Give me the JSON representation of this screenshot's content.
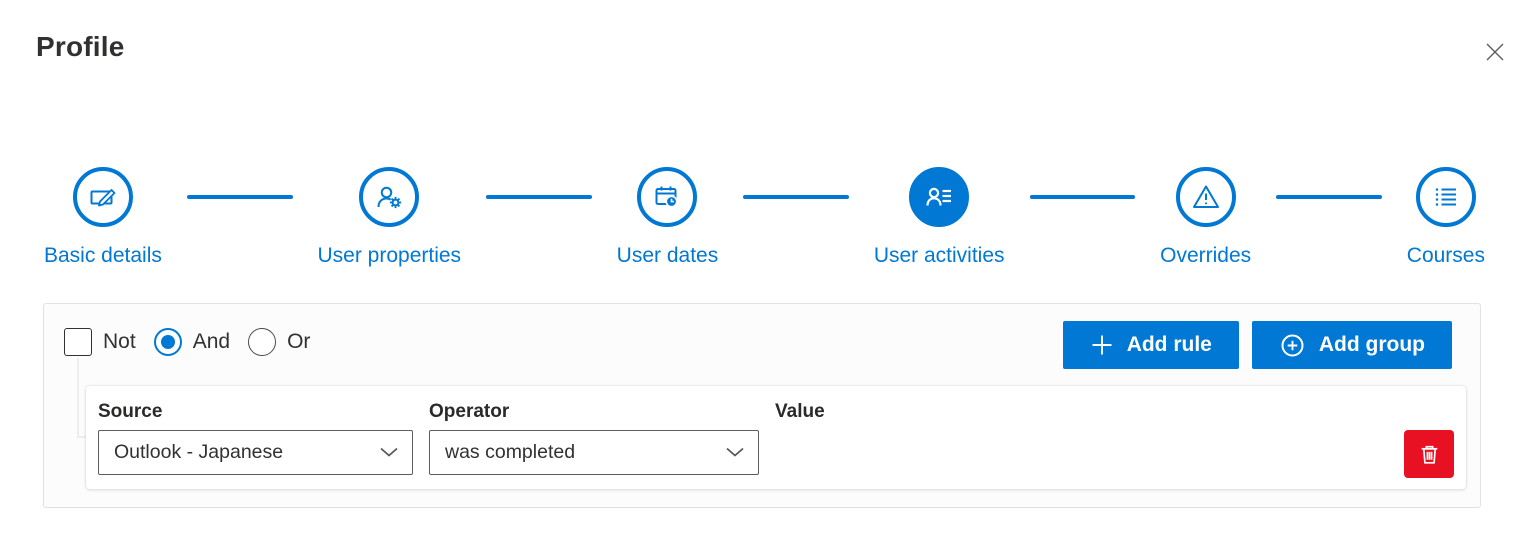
{
  "header": {
    "title": "Profile"
  },
  "stepper": {
    "steps": [
      {
        "label": "Basic details",
        "icon": "edit-icon",
        "state": "default"
      },
      {
        "label": "User properties",
        "icon": "user-settings-icon",
        "state": "default"
      },
      {
        "label": "User dates",
        "icon": "calendar-clock-icon",
        "state": "default"
      },
      {
        "label": "User activities",
        "icon": "user-activities-icon",
        "state": "active"
      },
      {
        "label": "Overrides",
        "icon": "warning-triangle-icon",
        "state": "default"
      },
      {
        "label": "Courses",
        "icon": "bulleted-list-icon",
        "state": "default"
      }
    ]
  },
  "rule_builder": {
    "logic": {
      "not_label": "Not",
      "not_checked": false,
      "and_label": "And",
      "or_label": "Or",
      "selected_operator": "And"
    },
    "actions": {
      "add_rule_label": "Add rule",
      "add_group_label": "Add group"
    },
    "rule": {
      "source": {
        "label": "Source",
        "selected_value": "Outlook - Japanese"
      },
      "operator": {
        "label": "Operator",
        "selected_value": "was completed"
      },
      "value": {
        "label": "Value"
      }
    }
  },
  "colors": {
    "accent": "#0078d4",
    "danger": "#e81123"
  }
}
